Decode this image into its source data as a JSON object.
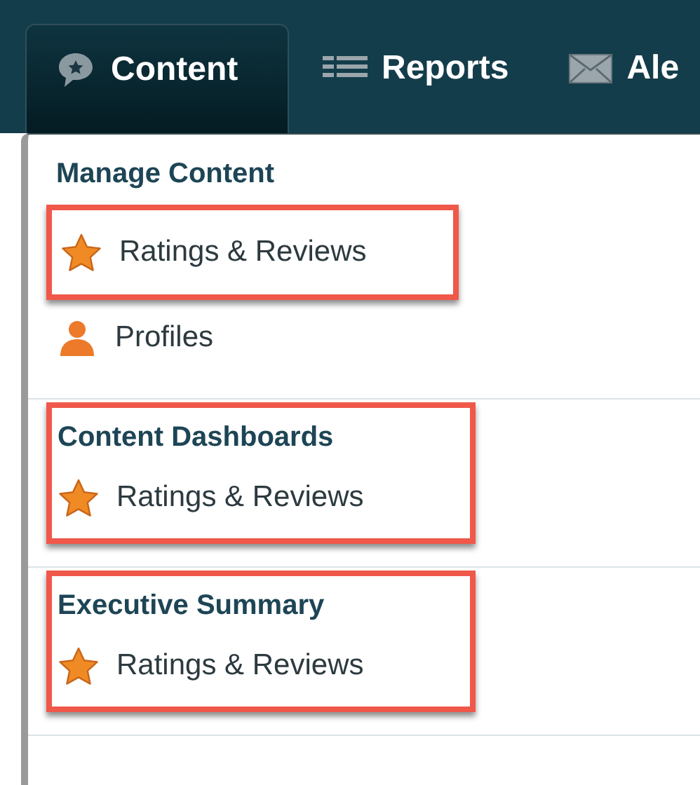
{
  "tabs": [
    {
      "label": "Content",
      "kind": "bubble",
      "selected": true
    },
    {
      "label": "Reports",
      "kind": "list",
      "selected": false
    },
    {
      "label": "Ale",
      "kind": "mail",
      "selected": false
    }
  ],
  "menu": {
    "sections": [
      {
        "heading": "Manage Content",
        "highlighted": false,
        "items": [
          {
            "label": "Ratings & Reviews",
            "kind": "star",
            "highlighted": true
          },
          {
            "label": "Profiles",
            "kind": "person",
            "highlighted": false
          }
        ]
      },
      {
        "heading": "Content Dashboards",
        "highlighted": true,
        "items": [
          {
            "label": "Ratings & Reviews",
            "kind": "star",
            "highlighted": false
          }
        ]
      },
      {
        "heading": "Executive Summary",
        "highlighted": true,
        "items": [
          {
            "label": "Ratings & Reviews",
            "kind": "star",
            "highlighted": false
          }
        ]
      }
    ]
  }
}
